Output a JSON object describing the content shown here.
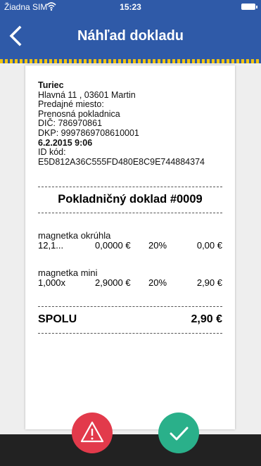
{
  "status": {
    "carrier": "Žiadna SIM",
    "time": "15:23"
  },
  "nav": {
    "title": "Náhľad dokladu"
  },
  "receipt": {
    "company": "Turiec",
    "address": "Hlavná 11 , 03601 Martin",
    "sale_place_label": "Predajné miesto:",
    "sale_place": "Prenosná pokladnica",
    "dic": "DIČ: 786970861",
    "dkp": "DKP: 9997869708610001",
    "datetime": "6.2.2015 9:06",
    "id_label": "ID kód:",
    "id_code": "E5D812A36C555FD480E8C9E744884374",
    "doc_title": "Pokladničný doklad #0009",
    "items": [
      {
        "name": "magnetka  okrúhla",
        "qty": "12,1...",
        "price": "0,0000 €",
        "vat": "20%",
        "total": "0,00 €"
      },
      {
        "name": "magnetka mini",
        "qty": "1,000x",
        "price": "2,9000 €",
        "vat": "20%",
        "total": "2,90 €"
      }
    ],
    "total_label": "SPOLU",
    "total_value": "2,90 €"
  },
  "icons": {
    "wifi": "wifi-icon",
    "battery": "battery-icon",
    "back": "chevron-left-icon",
    "warning": "warning-icon",
    "confirm": "checkmark-icon"
  },
  "colors": {
    "navbar": "#2f5aa8",
    "tape_accent": "#f1c40f",
    "warning": "#e23a4b",
    "confirm": "#2ab08a",
    "bottombar": "#222222"
  }
}
